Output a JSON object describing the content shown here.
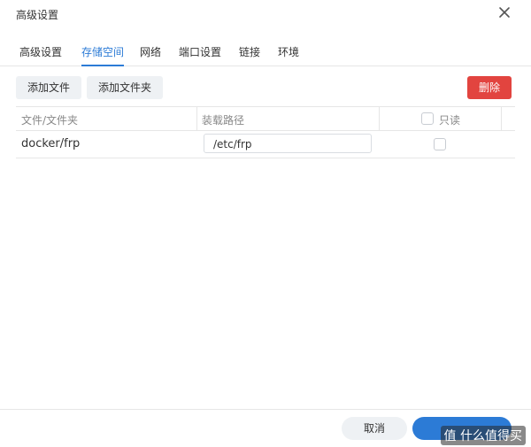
{
  "window": {
    "title": "高级设置"
  },
  "tabs": [
    {
      "label": "高级设置"
    },
    {
      "label": "存储空间"
    },
    {
      "label": "网络"
    },
    {
      "label": "端口设置"
    },
    {
      "label": "链接"
    },
    {
      "label": "环境"
    }
  ],
  "active_tab": "存储空间",
  "toolbar": {
    "add_file": "添加文件",
    "add_folder": "添加文件夹",
    "delete": "删除"
  },
  "table": {
    "headers": {
      "file": "文件/文件夹",
      "mount": "装载路径",
      "readonly": "只读"
    },
    "rows": [
      {
        "file": "docker/frp",
        "mount": "/etc/frp",
        "readonly": false
      }
    ]
  },
  "footer": {
    "cancel": "取消",
    "apply": ""
  },
  "watermark": "值 什么值得买",
  "colors": {
    "accent": "#2c7bd6",
    "danger": "#e2443f",
    "button_bg": "#eef1f4"
  }
}
